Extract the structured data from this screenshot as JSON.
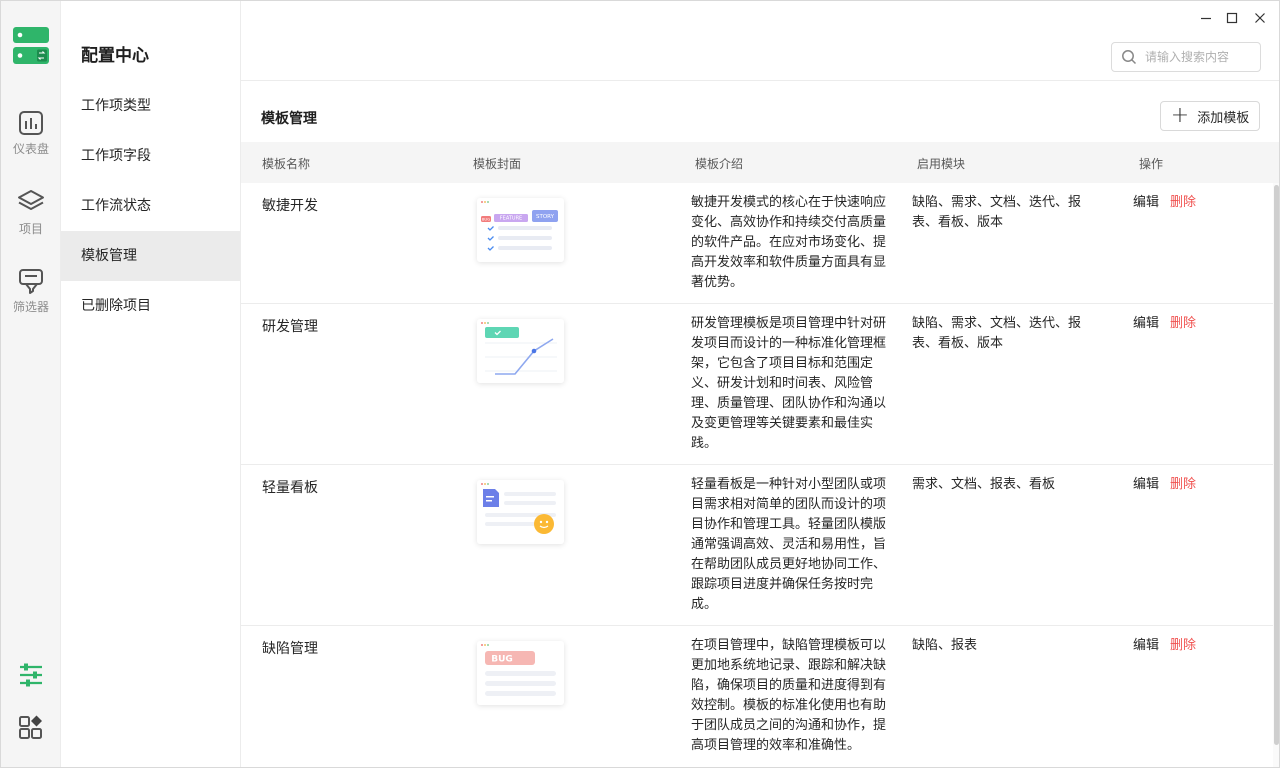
{
  "rail": {
    "items": [
      {
        "label": "仪表盘"
      },
      {
        "label": "项目"
      },
      {
        "label": "筛选器"
      }
    ]
  },
  "sidebar": {
    "title": "配置中心",
    "items": [
      {
        "label": "工作项类型"
      },
      {
        "label": "工作项字段"
      },
      {
        "label": "工作流状态"
      },
      {
        "label": "模板管理",
        "active": true
      },
      {
        "label": "已删除项目"
      }
    ]
  },
  "search": {
    "placeholder": "请输入搜索内容"
  },
  "main": {
    "title": "模板管理",
    "add_button": "添加模板",
    "columns": [
      "模板名称",
      "模板封面",
      "模板介绍",
      "启用模块",
      "操作"
    ],
    "rows": [
      {
        "name": "敏捷开发",
        "cover": "agile",
        "cover_labels": [
          "BUG",
          "FEATURE",
          "STORY"
        ],
        "desc": "敏捷开发模式的核心在于快速响应变化、高效协作和持续交付高质量的软件产品。在应对市场变化、提高开发效率和软件质量方面具有显著优势。",
        "modules": "缺陷、需求、文档、迭代、报表、看板、版本",
        "edit": "编辑",
        "delete": "删除"
      },
      {
        "name": "研发管理",
        "cover": "rd",
        "desc": "研发管理模板是项目管理中针对研发项目而设计的一种标准化管理框架，它包含了项目目标和范围定义、研发计划和时间表、风险管理、质量管理、团队协作和沟通以及变更管理等关键要素和最佳实践。",
        "modules": "缺陷、需求、文档、迭代、报表、看板、版本",
        "edit": "编辑",
        "delete": "删除"
      },
      {
        "name": "轻量看板",
        "cover": "kanban",
        "desc": "轻量看板是一种针对小型团队或项目需求相对简单的团队而设计的项目协作和管理工具。轻量团队模版通常强调高效、灵活和易用性，旨在帮助团队成员更好地协同工作、跟踪项目进度并确保任务按时完成。",
        "modules": "需求、文档、报表、看板",
        "edit": "编辑",
        "delete": "删除"
      },
      {
        "name": "缺陷管理",
        "cover": "bug",
        "cover_labels": [
          "BUG"
        ],
        "desc": "在项目管理中，缺陷管理模板可以更加地系统地记录、跟踪和解决缺陷，确保项目的质量和进度得到有效控制。模板的标准化使用也有助于团队成员之间的沟通和协作，提高项目管理的效率和准确性。",
        "modules": "缺陷、报表",
        "edit": "编辑",
        "delete": "删除"
      }
    ]
  },
  "colors": {
    "brand_green": "#2fb56a",
    "delete_red": "#f0504e",
    "active_bg": "#ebebeb"
  }
}
